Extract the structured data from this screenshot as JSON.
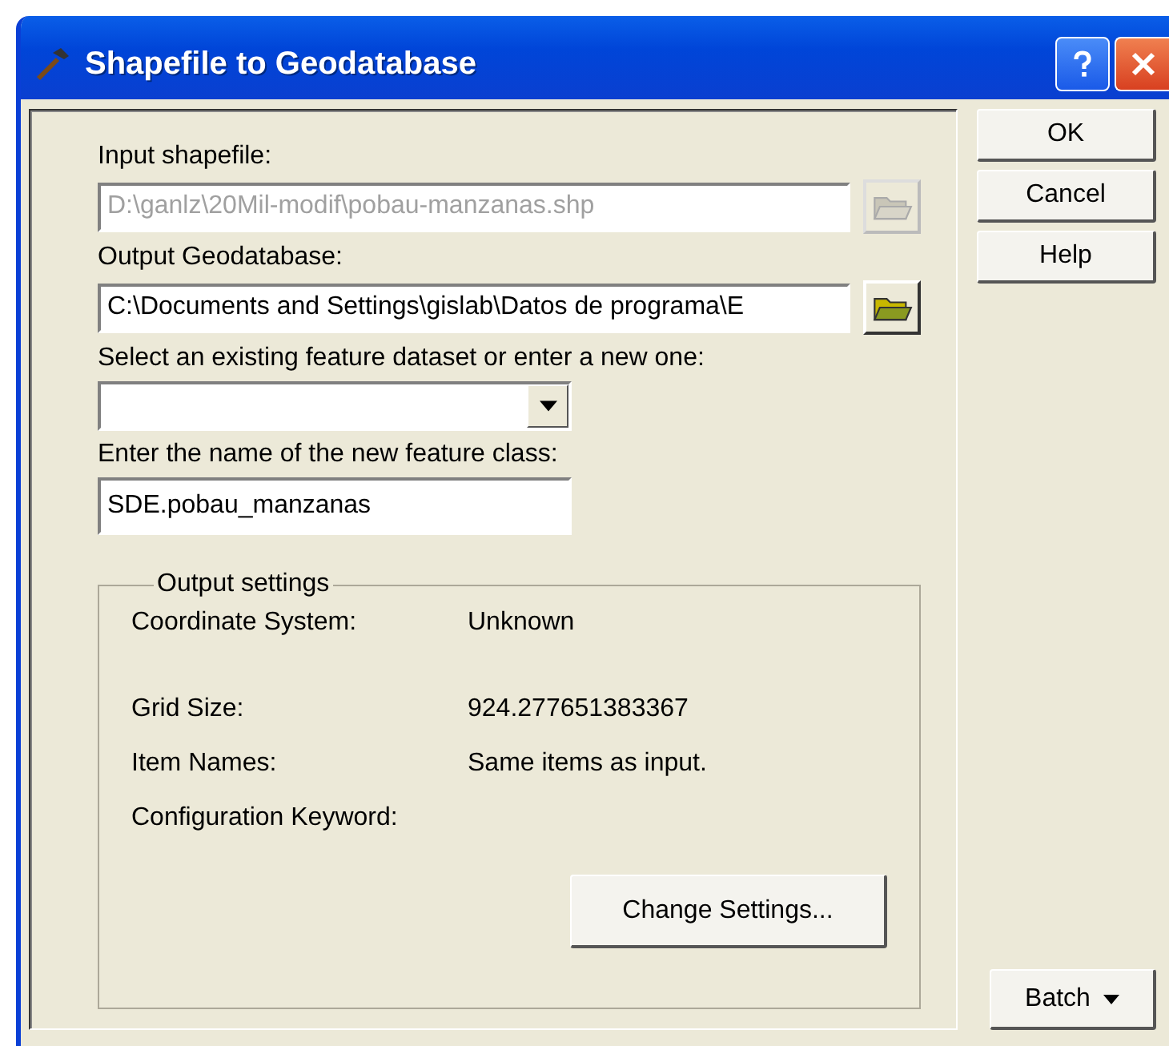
{
  "window": {
    "title": "Shapefile to Geodatabase"
  },
  "fields": [
    {
      "kind": "path",
      "label": "Input shapefile:",
      "value": "D:\\ganlz\\20Mil-modif\\pobau-manzanas.shp",
      "disabled": true
    },
    {
      "kind": "path",
      "label": "Output Geodatabase:",
      "value": "C:\\Documents and Settings\\gislab\\Datos de programa\\E",
      "disabled": false
    },
    {
      "kind": "combo",
      "label": "Select an existing feature dataset or enter a new one:",
      "disabled": false
    },
    {
      "kind": "text",
      "label": "Enter the name of the new feature class:",
      "value": "SDE.pobau_manzanas",
      "disabled": false
    }
  ],
  "output_settings": {
    "title": "Output settings",
    "rows": [
      {
        "label": "Coordinate System:",
        "value": "Unknown"
      },
      {
        "label": "Grid Size:",
        "value": "924.277651383367"
      },
      {
        "label": "Item Names:",
        "value": "Same items as input."
      },
      {
        "label": "Configuration Keyword:"
      }
    ],
    "button": "Change Settings..."
  },
  "buttons": [
    "OK",
    "Cancel",
    "Help"
  ],
  "batch_button": "Batch"
}
